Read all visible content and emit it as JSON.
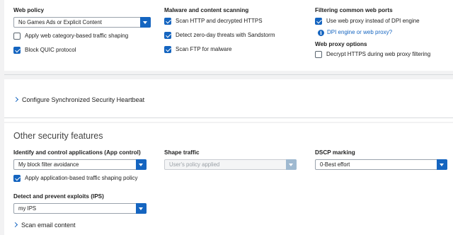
{
  "web_policy": {
    "heading": "Web policy",
    "selected": "No Games Ads or Explicit Content",
    "checkboxes": [
      {
        "label": "Apply web category-based traffic shaping",
        "checked": false
      },
      {
        "label": "Block QUIC protocol",
        "checked": true
      }
    ]
  },
  "malware": {
    "heading": "Malware and content scanning",
    "checkboxes": [
      {
        "label": "Scan HTTP and decrypted HTTPS",
        "checked": true
      },
      {
        "label": "Detect zero-day threats with Sandstorm",
        "checked": true
      },
      {
        "label": "Scan FTP for malware",
        "checked": true
      }
    ]
  },
  "filtering": {
    "heading": "Filtering common web ports",
    "checkbox": {
      "label": "Use web proxy instead of DPI engine",
      "checked": true
    },
    "info_link": "DPI engine or web proxy?"
  },
  "web_proxy": {
    "heading": "Web proxy options",
    "checkbox": {
      "label": "Decrypt HTTPS during web proxy filtering",
      "checked": false
    }
  },
  "heartbeat": {
    "label": "Configure Synchronized Security Heartbeat"
  },
  "other": {
    "title": "Other security features",
    "app_control": {
      "heading": "Identify and control applications (App control)",
      "selected": "My block filter avoidance",
      "checkbox": {
        "label": "Apply application-based traffic shaping policy",
        "checked": true
      }
    },
    "shape_traffic": {
      "heading": "Shape traffic",
      "selected": "User's policy applied"
    },
    "dscp": {
      "heading": "DSCP marking",
      "selected": "0-Best effort"
    },
    "ips": {
      "heading": "Detect and prevent exploits (IPS)",
      "selected": "my IPS"
    },
    "scan_email": {
      "label": "Scan email content"
    }
  },
  "colors": {
    "accent": "#1565c0",
    "panel": "#ffffff",
    "background": "#f2f2f3"
  }
}
